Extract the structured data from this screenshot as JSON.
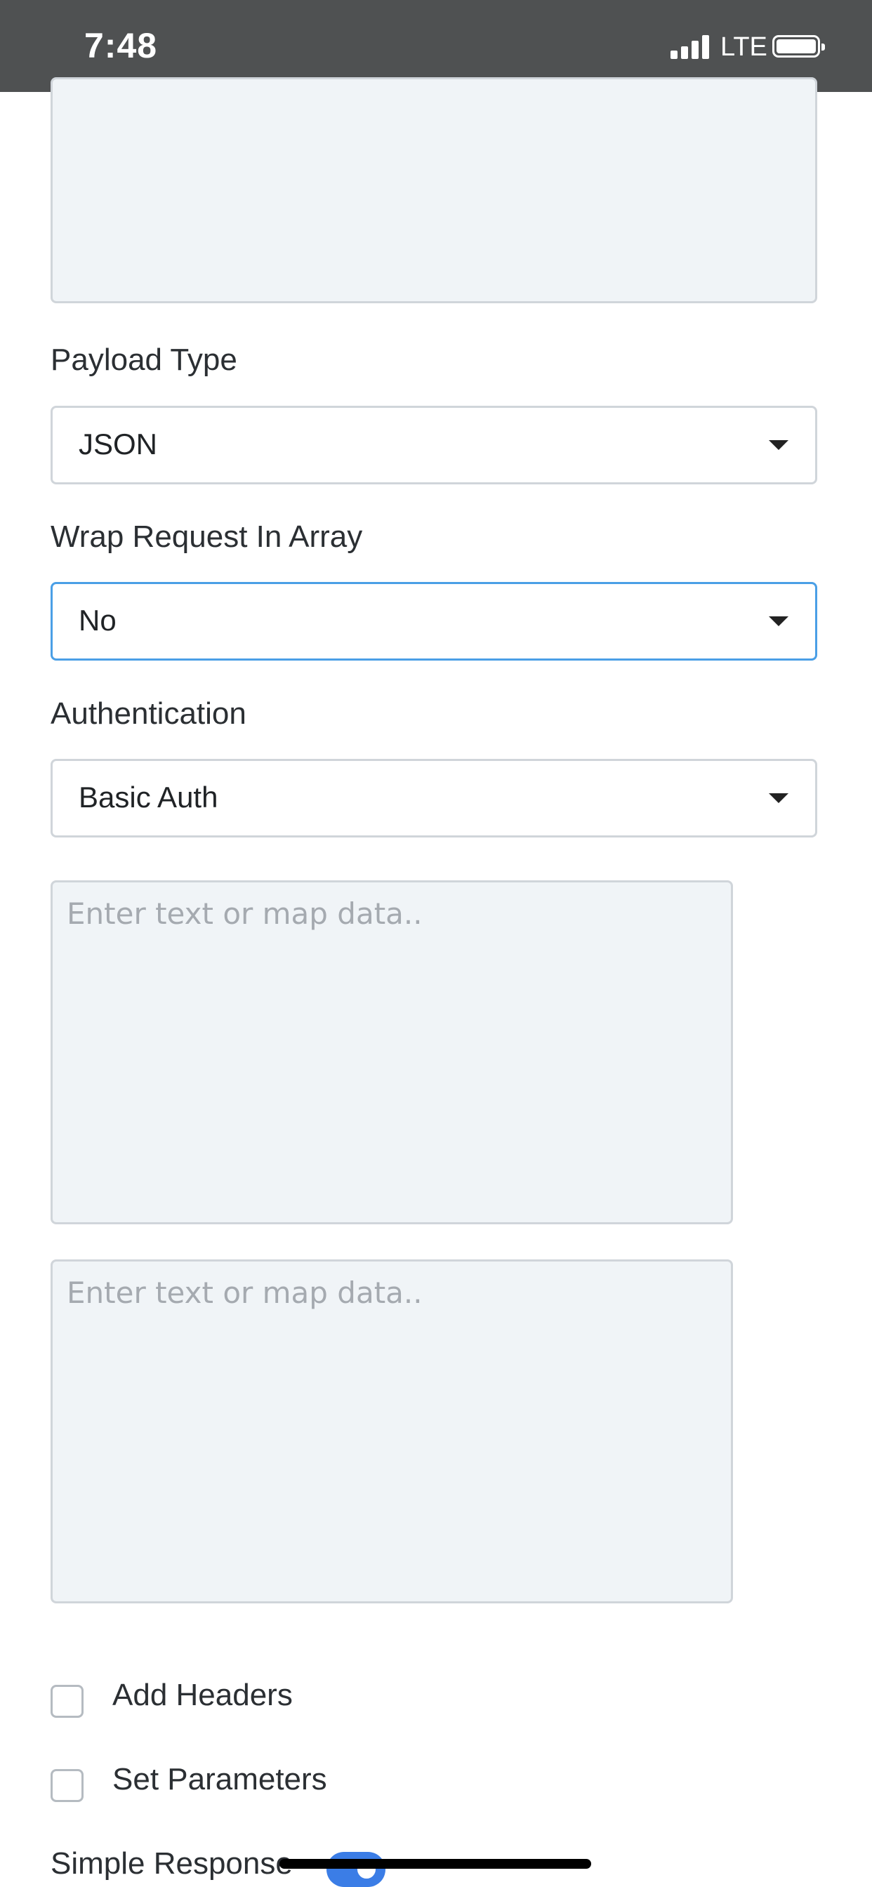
{
  "status_bar": {
    "time": "7:48",
    "network": "LTE",
    "signal_bars": 4,
    "battery_level": 1.0
  },
  "form": {
    "payload_type": {
      "label": "Payload Type",
      "value": "JSON"
    },
    "wrap_request": {
      "label": "Wrap Request In Array",
      "value": "No"
    },
    "authentication": {
      "label": "Authentication",
      "value": "Basic Auth"
    },
    "username_field": {
      "placeholder": "Enter text or map data.."
    },
    "password_field": {
      "placeholder": "Enter text or map data.."
    },
    "add_headers": {
      "label": "Add Headers",
      "checked": false
    },
    "set_parameters": {
      "label": "Set Parameters",
      "checked": false
    },
    "simple_response": {
      "label": "Simple Response",
      "enabled": true
    }
  },
  "colors": {
    "status_bar_bg": "#4f5152",
    "focus_border": "#4a9fe6",
    "toggle_accent": "#3b7de6",
    "field_bg": "#f0f4f7"
  },
  "icons": [
    "signal-icon",
    "battery-icon",
    "chevron-down-icon"
  ]
}
